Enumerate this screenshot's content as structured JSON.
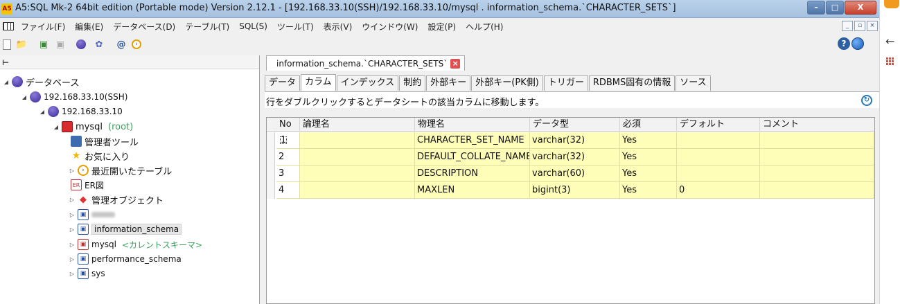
{
  "window": {
    "app_icon": "a5-sql-icon",
    "title": "A5:SQL Mk-2 64bit edition (Portable mode) Version 2.12.1 - [192.168.33.10(SSH)/192.168.33.10/mysql . information_schema.`CHARACTER_SETS`]",
    "minimize": "–",
    "maximize": "□",
    "close": "X"
  },
  "menubar": {
    "items": [
      "ファイル(F)",
      "編集(E)",
      "データベース(D)",
      "テーブル(T)",
      "SQL(S)",
      "ツール(T)",
      "表示(V)",
      "ウインドウ(W)",
      "設定(P)",
      "ヘルプ(H)"
    ],
    "mdi_buttons": [
      "_",
      "▫",
      "×"
    ]
  },
  "toolbar": {
    "help_label": "?",
    "icons": [
      "new-document-icon",
      "open-icon",
      "connect-icon",
      "disconnect-icon",
      "database-icon",
      "settings-icon",
      "at-icon",
      "recent-icon",
      "help-icon",
      "web-icon"
    ]
  },
  "tree": {
    "root": "データベース",
    "connection": "192.168.33.10(SSH)",
    "host": "192.168.33.10",
    "db_name": "mysql",
    "db_user": "(root)",
    "nodes": {
      "admin_tool": "管理者ツール",
      "favorites": "お気に入り",
      "recent_tables": "最近開いたテーブル",
      "er": "ER図",
      "admin_objects": "管理オブジェクト"
    },
    "schemas": [
      {
        "name": "",
        "blurred": true
      },
      {
        "name": "information_schema"
      },
      {
        "name": "mysql",
        "note": "<カレントスキーマ>"
      },
      {
        "name": "performance_schema"
      },
      {
        "name": "sys"
      }
    ]
  },
  "document_tab": {
    "label": "information_schema.`CHARACTER_SETS`",
    "close": "×"
  },
  "sub_tabs": [
    "データ",
    "カラム",
    "インデックス",
    "制約",
    "外部キー",
    "外部キー(PK側)",
    "トリガー",
    "RDBMS固有の情報",
    "ソース"
  ],
  "active_sub_tab": "カラム",
  "info_text": "行をダブルクリックするとデータシートの該当カラムに移動します。",
  "grid": {
    "headers": [
      "No",
      "論理名",
      "物理名",
      "データ型",
      "必須",
      "デフォルト",
      "コメント"
    ],
    "rows": [
      [
        "1",
        "",
        "CHARACTER_SET_NAME",
        "varchar(32)",
        "Yes",
        "",
        ""
      ],
      [
        "2",
        "",
        "DEFAULT_COLLATE_NAME",
        "varchar(32)",
        "Yes",
        "",
        ""
      ],
      [
        "3",
        "",
        "DESCRIPTION",
        "varchar(60)",
        "Yes",
        "",
        ""
      ],
      [
        "4",
        "",
        "MAXLEN",
        "bigint(3)",
        "Yes",
        "0",
        ""
      ]
    ],
    "row_color": "#fefeb8"
  }
}
